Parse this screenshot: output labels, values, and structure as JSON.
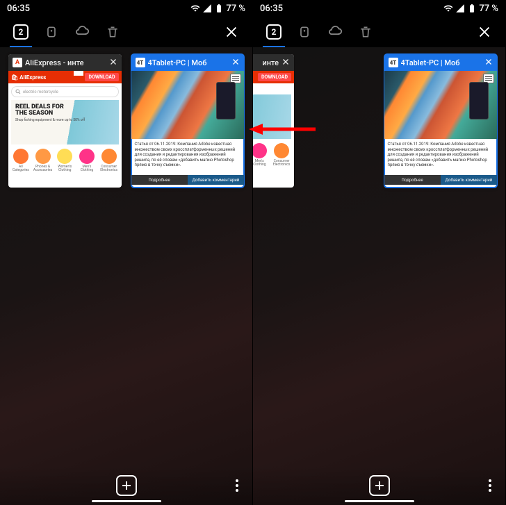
{
  "status": {
    "time": "06:35",
    "battery": "77 %"
  },
  "toolbar": {
    "tab_count": "2"
  },
  "tabs": {
    "ali": {
      "title": "AliExpress - инте",
      "favicon": "A",
      "download": "DOWNLOAD",
      "logo": "AliExpress",
      "search": "electric motorcycle",
      "banner_title1": "REEL DEALS FOR",
      "banner_title2": "THE SEASON",
      "banner_sub": "Shop fishing equipment &\nmore up to 50% off",
      "cats": [
        {
          "label": "All Categories",
          "color": "#ff7733"
        },
        {
          "label": "Phones & Accessories",
          "color": "#ff9944"
        },
        {
          "label": "Women's Clothing",
          "color": "#ffdd55"
        },
        {
          "label": "Men's Clothing",
          "color": "#ff3388"
        },
        {
          "label": "Consumer Electronics",
          "color": "#ff8833"
        }
      ]
    },
    "t4": {
      "title": "4Tablet-PC | Моб",
      "favicon": "4T",
      "article": "Статья от 06.11.2019: Компания Adobe известная множеством своих кроссплатформенных решений для создания и редактирования изображений решила, по её словам «добавить магию Photoshop прямо в точку съемки».",
      "more": "Подробнее",
      "comment": "Добавить комментарий"
    }
  }
}
